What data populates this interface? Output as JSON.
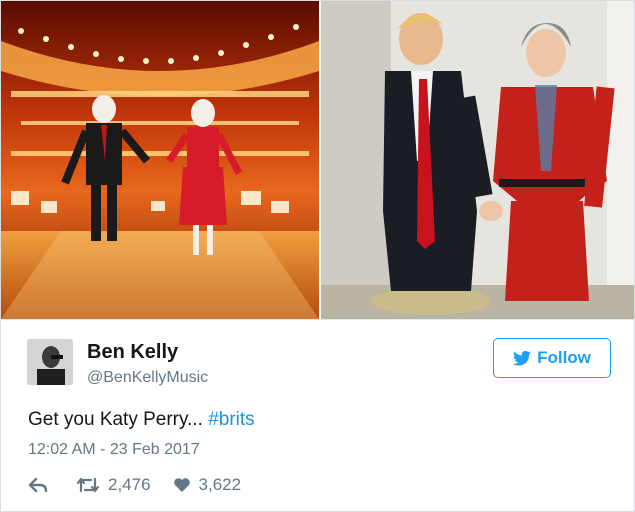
{
  "tweet": {
    "author_name": "Ben Kelly",
    "author_handle": "@BenKellyMusic",
    "follow_label": "Follow",
    "text_main": "Get you Katy Perry... ",
    "hashtag": "#brits",
    "timestamp": "12:02 AM - 23 Feb 2017",
    "retweet_count": "2,476",
    "like_count": "3,622"
  },
  "colors": {
    "accent": "#1da1f2",
    "hashtag": "#1b95e0",
    "muted": "#657786",
    "text": "#14171a"
  },
  "icons": {
    "reply": "reply-icon",
    "retweet": "retweet-icon",
    "like": "heart-icon",
    "follow": "twitter-bird-icon"
  }
}
